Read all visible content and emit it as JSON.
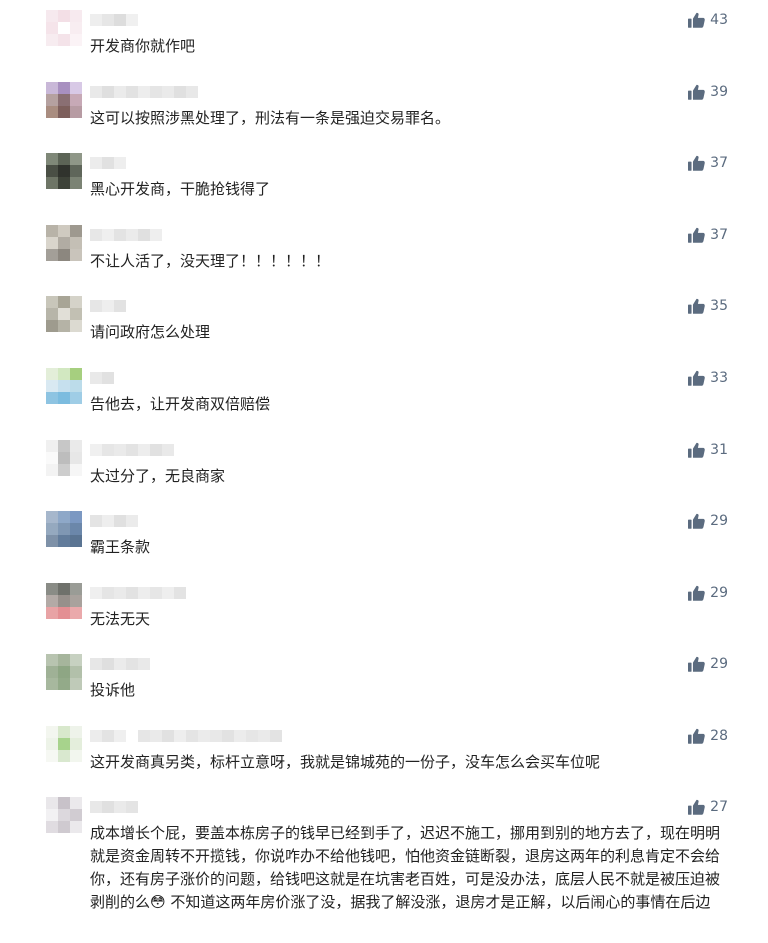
{
  "like_color": "#5b6b7f",
  "comments": [
    {
      "text": "开发商你就作吧",
      "likes": "43",
      "avatar": [
        "#f6e9ee",
        "#f3dfe6",
        "#f7eaef",
        "#f5e4ea",
        "#ffffff",
        "#f8edf1",
        "#f7ecf0",
        "#f4e3e9",
        "#fbf3f6"
      ],
      "nick": [
        "#eeeeee",
        "#e6e6e6",
        "#dddddd",
        "#f0f0f0"
      ]
    },
    {
      "text": "这可以按照涉黑处理了，刑法有一条是强迫交易罪名。",
      "likes": "39",
      "avatar": [
        "#c9b8d8",
        "#a890c0",
        "#d8c9e6",
        "#b5a1a0",
        "#8a6f73",
        "#c7a9b6",
        "#a98d80",
        "#7d5f5c",
        "#b79ba3"
      ],
      "nick": [
        "#e9e9e9",
        "#dfdfdf",
        "#ebebeb",
        "#e2e2e2",
        "#ededed",
        "#e5e5e5",
        "#eaeaea",
        "#e0e0e0",
        "#e8e8e8"
      ]
    },
    {
      "text": "黑心开发商，干脆抢钱得了",
      "likes": "37",
      "avatar": [
        "#7f8878",
        "#5c6456",
        "#8f9788",
        "#4a4f45",
        "#30332d",
        "#5f665a",
        "#6e7566",
        "#3d4238",
        "#7b8374"
      ],
      "nick": [
        "#ececec",
        "#e1e1e1",
        "#eeeeee"
      ]
    },
    {
      "text": "不让人活了，没天理了！！！！！！",
      "likes": "37",
      "avatar": [
        "#b8b3a8",
        "#cfcac0",
        "#9e998f",
        "#d9d5cc",
        "#b1aca3",
        "#c4bfb5",
        "#a39f98",
        "#8c877f",
        "#c9c4bb"
      ],
      "nick": [
        "#e7e7e7",
        "#efefef",
        "#e3e3e3",
        "#ebebeb",
        "#e0e0e0",
        "#eeeeee"
      ]
    },
    {
      "text": "请问政府怎么处理",
      "likes": "35",
      "avatar": [
        "#c8c6ba",
        "#a8a596",
        "#d5d3c9",
        "#b7b5a9",
        "#e1dfd7",
        "#c2c0b3",
        "#9e9b8e",
        "#b5b3a6",
        "#dcdad1"
      ],
      "nick": [
        "#e6e6e6",
        "#eeeeee",
        "#e2e2e2"
      ]
    },
    {
      "text": "告他去，让开发商双倍赔偿",
      "likes": "33",
      "avatar": [
        "#e3eed9",
        "#d2e8c1",
        "#a6cf7f",
        "#d9e9f2",
        "#c6e0ee",
        "#bcdcea",
        "#8ec4e2",
        "#7cbcdf",
        "#9fcde6"
      ],
      "nick": [
        "#e9e9e9",
        "#e1e1e1"
      ]
    },
    {
      "text": "太过分了，无良商家",
      "likes": "31",
      "avatar": [
        "#f0f0f0",
        "#c7c7c7",
        "#eaeaea",
        "#fafafa",
        "#bdbdbd",
        "#e7e7e7",
        "#f3f3f3",
        "#cdcdcd",
        "#f6f6f6"
      ],
      "nick": [
        "#f0f0f0",
        "#e6e6e6",
        "#eaeaea",
        "#e3e3e3",
        "#ededed",
        "#e1e1e1",
        "#e9e9e9"
      ]
    },
    {
      "text": "霸王条款",
      "likes": "29",
      "avatar": [
        "#a6b7cc",
        "#8ea8c8",
        "#7b98c2",
        "#95a9bf",
        "#7f97b3",
        "#6b87aa",
        "#7e91a8",
        "#627c9b",
        "#5a7492"
      ],
      "nick": [
        "#e4e4e4",
        "#eeeeee",
        "#e0e0e0",
        "#ebebeb"
      ]
    },
    {
      "text": "无法无天",
      "likes": "29",
      "avatar": [
        "#8a8c86",
        "#6f716b",
        "#9a9c96",
        "#b3aaa6",
        "#97908b",
        "#a9a29d",
        "#e8a3a5",
        "#e38f93",
        "#eaa9ab"
      ],
      "nick": [
        "#efefef",
        "#e5e5e5",
        "#eaeaea",
        "#e2e2e2",
        "#ededed",
        "#e6e6e6",
        "#eeeeee",
        "#e3e3e3"
      ]
    },
    {
      "text": "投诉他",
      "likes": "29",
      "avatar": [
        "#b8c4b0",
        "#a6b59c",
        "#c7d1c1",
        "#9fb196",
        "#8ea684",
        "#b2c0aa",
        "#a7b89e",
        "#93aa89",
        "#bfcab8"
      ],
      "nick": [
        "#e7e7e7",
        "#dfdfdf",
        "#ebebeb",
        "#e3e3e3",
        "#e9e9e9"
      ]
    },
    {
      "text": "这开发商真另类，标杆立意呀，我就是锦城苑的一份子，没车怎么会买车位呢",
      "likes": "28",
      "avatar": [
        "#f3f6ef",
        "#d8e8cc",
        "#eef3ea",
        "#edf3e8",
        "#a7d38c",
        "#e4eedc",
        "#f6f8f3",
        "#d9e8cf",
        "#f2f6ee"
      ],
      "nick": [
        "#ececec",
        "#e3e3e3",
        "#efefef",
        "#ffffff",
        "#e6e6e6",
        "#eaeaea",
        "#e1e1e1",
        "#eeeeee",
        "#e4e4e4",
        "#ebebeb",
        "#e8e8e8",
        "#e2e2e2",
        "#ececec",
        "#e6e6e6",
        "#eaeaea",
        "#e3e3e3"
      ]
    },
    {
      "text": "成本增长个屁，要盖本栋房子的钱早已经到手了，迟迟不施工，挪用到别的地方去了，现在明明就是资金周转不开揽钱，你说咋办不给他钱吧，怕他资金链断裂，退房这两年的利息肯定不会给你，还有房子涨价的问题，给钱吧这就是在坑害老百姓，可是没办法，底层人民不就是被压迫被剥削的么😳 不知道这两年房价涨了没，据我了解没涨，退房才是正解，以后闹心的事情在后边",
      "likes": "27",
      "avatar": [
        "#e9e7ea",
        "#c8c2c9",
        "#ebe9ec",
        "#f2f1f3",
        "#dcd8dd",
        "#d1ccd2",
        "#e0dce1",
        "#cfcad0",
        "#ebe9ec"
      ],
      "nick": [
        "#e8e8e8",
        "#e0e0e0",
        "#eaeaea",
        "#e4e4e4"
      ]
    }
  ]
}
